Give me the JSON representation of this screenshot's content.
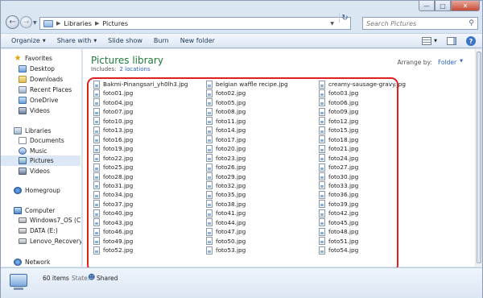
{
  "window": {
    "caption_buttons": [
      "minimize",
      "maximize",
      "close"
    ]
  },
  "address": {
    "crumbs": [
      "Libraries",
      "Pictures"
    ],
    "search_placeholder": "Search Pictures"
  },
  "toolbar": {
    "organize": "Organize",
    "share_with": "Share with",
    "slide_show": "Slide show",
    "burn": "Burn",
    "new_folder": "New folder"
  },
  "nav": {
    "favorites": "Favorites",
    "desktop": "Desktop",
    "downloads": "Downloads",
    "recent_places": "Recent Places",
    "onedrive": "OneDrive",
    "fav_videos": "Videos",
    "libraries": "Libraries",
    "documents": "Documents",
    "music": "Music",
    "pictures": "Pictures",
    "lib_videos": "Videos",
    "homegroup": "Homegroup",
    "computer": "Computer",
    "drive_c": "Windows7_OS (C",
    "drive_e": "DATA (E:)",
    "drive_recovery": "Lenovo_Recovery",
    "network": "Network"
  },
  "library": {
    "title": "Pictures library",
    "includes_label": "Includes:",
    "includes_link": "2 locations",
    "arrange_label": "Arrange by:",
    "arrange_value": "Folder"
  },
  "files": [
    [
      "Bakmi-Pinangsari_yh0lh3.jpg",
      "belgian waffle recipe.jpg",
      "creamy-sausage-gravy.jpg"
    ],
    [
      "foto01.jpg",
      "foto02.jpg",
      "foto03.jpg"
    ],
    [
      "foto04.jpg",
      "foto05.jpg",
      "foto06.jpg"
    ],
    [
      "foto07.jpg",
      "foto08.jpg",
      "foto09.jpg"
    ],
    [
      "foto10.jpg",
      "foto11.jpg",
      "foto12.jpg"
    ],
    [
      "foto13.jpg",
      "foto14.jpg",
      "foto15.jpg"
    ],
    [
      "foto16.jpg",
      "foto17.jpg",
      "foto18.jpg"
    ],
    [
      "foto19.jpg",
      "foto20.jpg",
      "foto21.jpg"
    ],
    [
      "foto22.jpg",
      "foto23.jpg",
      "foto24.jpg"
    ],
    [
      "foto25.jpg",
      "foto26.jpg",
      "foto27.jpg"
    ],
    [
      "foto28.jpg",
      "foto29.jpg",
      "foto30.jpg"
    ],
    [
      "foto31.jpg",
      "foto32.jpg",
      "foto33.jpg"
    ],
    [
      "foto34.jpg",
      "foto35.jpg",
      "foto36.jpg"
    ],
    [
      "foto37.jpg",
      "foto38.jpg",
      "foto39.jpg"
    ],
    [
      "foto40.jpg",
      "foto41.jpg",
      "foto42.jpg"
    ],
    [
      "foto43.jpg",
      "foto44.jpg",
      "foto45.jpg"
    ],
    [
      "foto46.jpg",
      "foto47.jpg",
      "foto48.jpg"
    ],
    [
      "foto49.jpg",
      "foto50.jpg",
      "foto51.jpg"
    ],
    [
      "foto52.jpg",
      "foto53.jpg",
      "foto54.jpg"
    ]
  ],
  "details": {
    "count": "60 items",
    "state_label": "State:",
    "state_value": "Shared"
  },
  "colors": {
    "library_title": "#1e7b3a",
    "link": "#2b62c1",
    "highlight_border": "#e01f1f"
  },
  "icons": {
    "file": "jpg-file-icon",
    "favorites": "star-icon",
    "help": "help-icon"
  }
}
